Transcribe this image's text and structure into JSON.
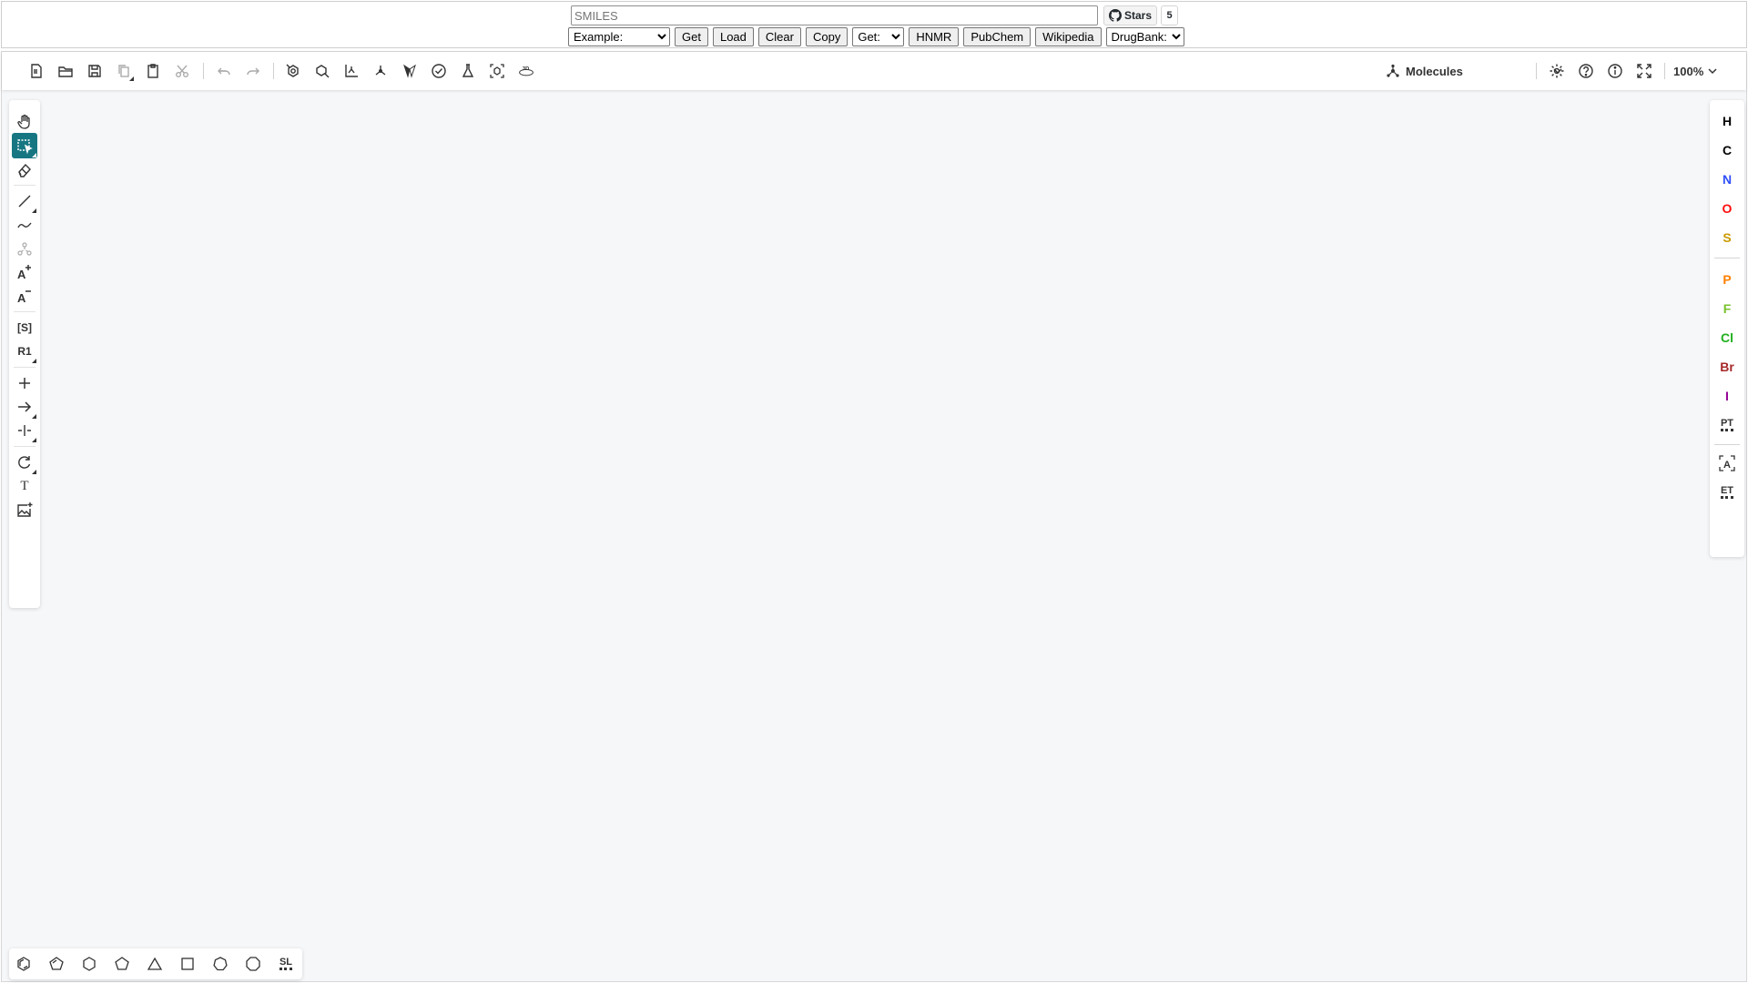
{
  "form": {
    "smiles_placeholder": "SMILES",
    "smiles_value": "",
    "github_label": "Stars",
    "github_count": "5",
    "example_select": "Example:",
    "get_button": "Get",
    "load_button": "Load",
    "clear_button": "Clear",
    "copy_button": "Copy",
    "get_select": "Get:",
    "hnmr_button": "HNMR",
    "pubchem_button": "PubChem",
    "wikipedia_button": "Wikipedia",
    "drugbank_select": "DrugBank:"
  },
  "toolbar": {
    "mode_label": "Molecules",
    "zoom_label": "100%",
    "icons": [
      "new-file-icon",
      "open-file-icon",
      "save-icon",
      "copy-icon",
      "paste-icon",
      "cut-icon",
      "undo-icon",
      "redo-icon",
      "aromatize-icon",
      "layout-icon",
      "clean-up-icon",
      "calculate-icon",
      "stereo-icon",
      "check-structure-icon",
      "analyse-icon",
      "3d-view-icon",
      "settings-icon",
      "help-icon",
      "about-icon",
      "fullscreen-icon"
    ]
  },
  "left_tools": {
    "sgroup_label": "[S]",
    "rgroup_label": "R1",
    "text_label": "T"
  },
  "atoms": [
    {
      "symbol": "H",
      "color": "#000000"
    },
    {
      "symbol": "C",
      "color": "#000000"
    },
    {
      "symbol": "N",
      "color": "#304ff7"
    },
    {
      "symbol": "O",
      "color": "#ff0d0d"
    },
    {
      "symbol": "S",
      "color": "#c99a00"
    },
    {
      "symbol": "P",
      "color": "#ff8000"
    },
    {
      "symbol": "F",
      "color": "#78c22e"
    },
    {
      "symbol": "Cl",
      "color": "#1fb11f"
    },
    {
      "symbol": "Br",
      "color": "#a62929"
    },
    {
      "symbol": "I",
      "color": "#940094"
    }
  ],
  "right_tools": {
    "periodic_table_label": "PT",
    "extended_table_label": "ET"
  },
  "templates": {
    "structure_library_label": "SL",
    "icons": [
      "benzene-icon",
      "cyclopentadiene-icon",
      "cyclohexane-icon",
      "cyclopentane-icon",
      "cyclopropane-icon",
      "cyclobutane-icon",
      "cycloheptane-icon",
      "cyclooctane-icon"
    ]
  },
  "colors": {
    "accent": "#167782",
    "canvas_bg": "#f6f7f9"
  }
}
